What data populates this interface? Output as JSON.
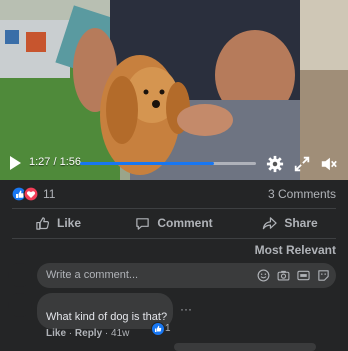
{
  "video": {
    "time_display": "1:27 / 1:56",
    "progress_fraction": 0.76,
    "accent": "#1877f2"
  },
  "icons": {
    "play": "play-icon",
    "settings": "gear-icon",
    "fullscreen": "expand-icon",
    "mute": "speaker-muted-icon",
    "like_reaction": "thumbs-up-icon",
    "love_reaction": "heart-icon"
  },
  "post": {
    "reaction_count": "11",
    "comments_count": "3 Comments",
    "actions": {
      "like": "Like",
      "comment": "Comment",
      "share": "Share"
    },
    "sort_label": "Most Relevant"
  },
  "composer": {
    "placeholder": "Write a comment..."
  },
  "comment": {
    "text": "What kind of dog is that?",
    "like_label": "Like",
    "reply_label": "Reply",
    "age": "41w",
    "like_count": "1"
  }
}
